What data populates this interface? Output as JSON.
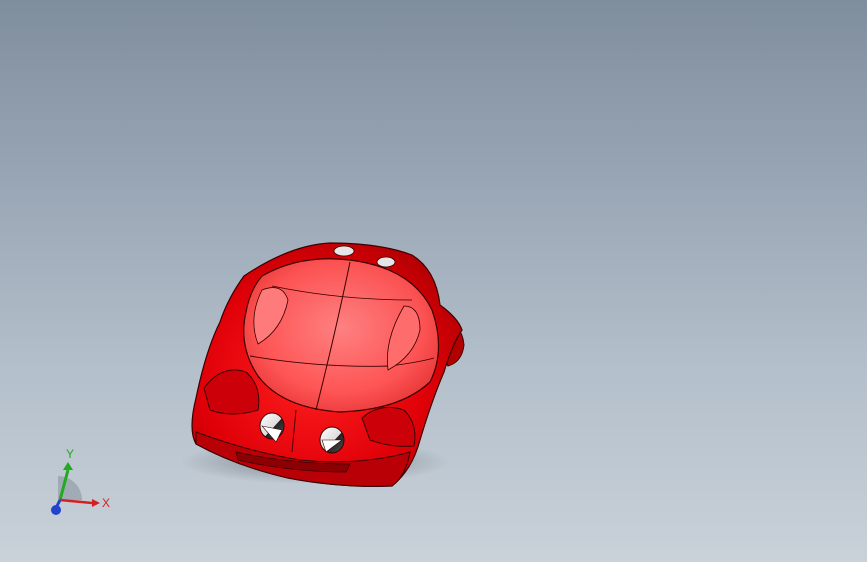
{
  "viewport": {
    "background_top": "#7f8e9d",
    "background_bottom": "#c9d1d9"
  },
  "model": {
    "color_body": "#e8000a",
    "color_canopy": "#ff6b6b",
    "color_edge": "#3a0000",
    "icon": "3d-car-body"
  },
  "triad": {
    "x_label": "X",
    "y_label": "Y",
    "x_color": "#d42020",
    "y_color": "#22aa22",
    "z_color": "#2244cc"
  }
}
